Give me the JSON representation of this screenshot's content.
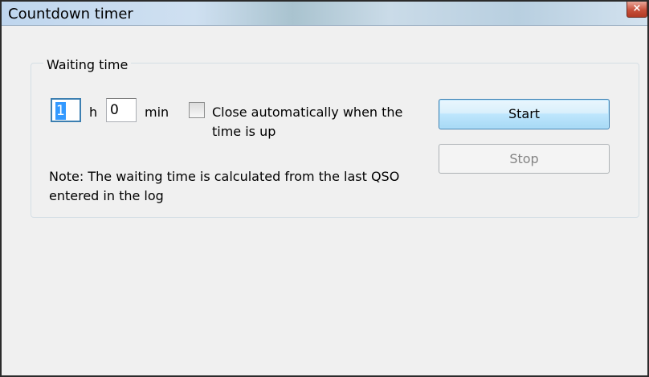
{
  "window": {
    "title": "Countdown timer",
    "close_glyph": "×"
  },
  "group": {
    "legend": "Waiting time"
  },
  "hours": {
    "value": "1",
    "unit": "h"
  },
  "minutes": {
    "value": "0",
    "unit": "min"
  },
  "auto_close": {
    "label": "Close automatically when the time is up",
    "checked": false
  },
  "buttons": {
    "start": "Start",
    "stop": "Stop"
  },
  "note": "Note: The waiting time is calculated from the last QSO entered in the log",
  "colors": {
    "title_bar": "#c8dbee",
    "window_bg": "#f0f0f0",
    "focus_border": "#3c7fb1",
    "selection": "#3399ff",
    "disabled_text": "#838383"
  },
  "icons": {
    "close": "close-icon"
  }
}
